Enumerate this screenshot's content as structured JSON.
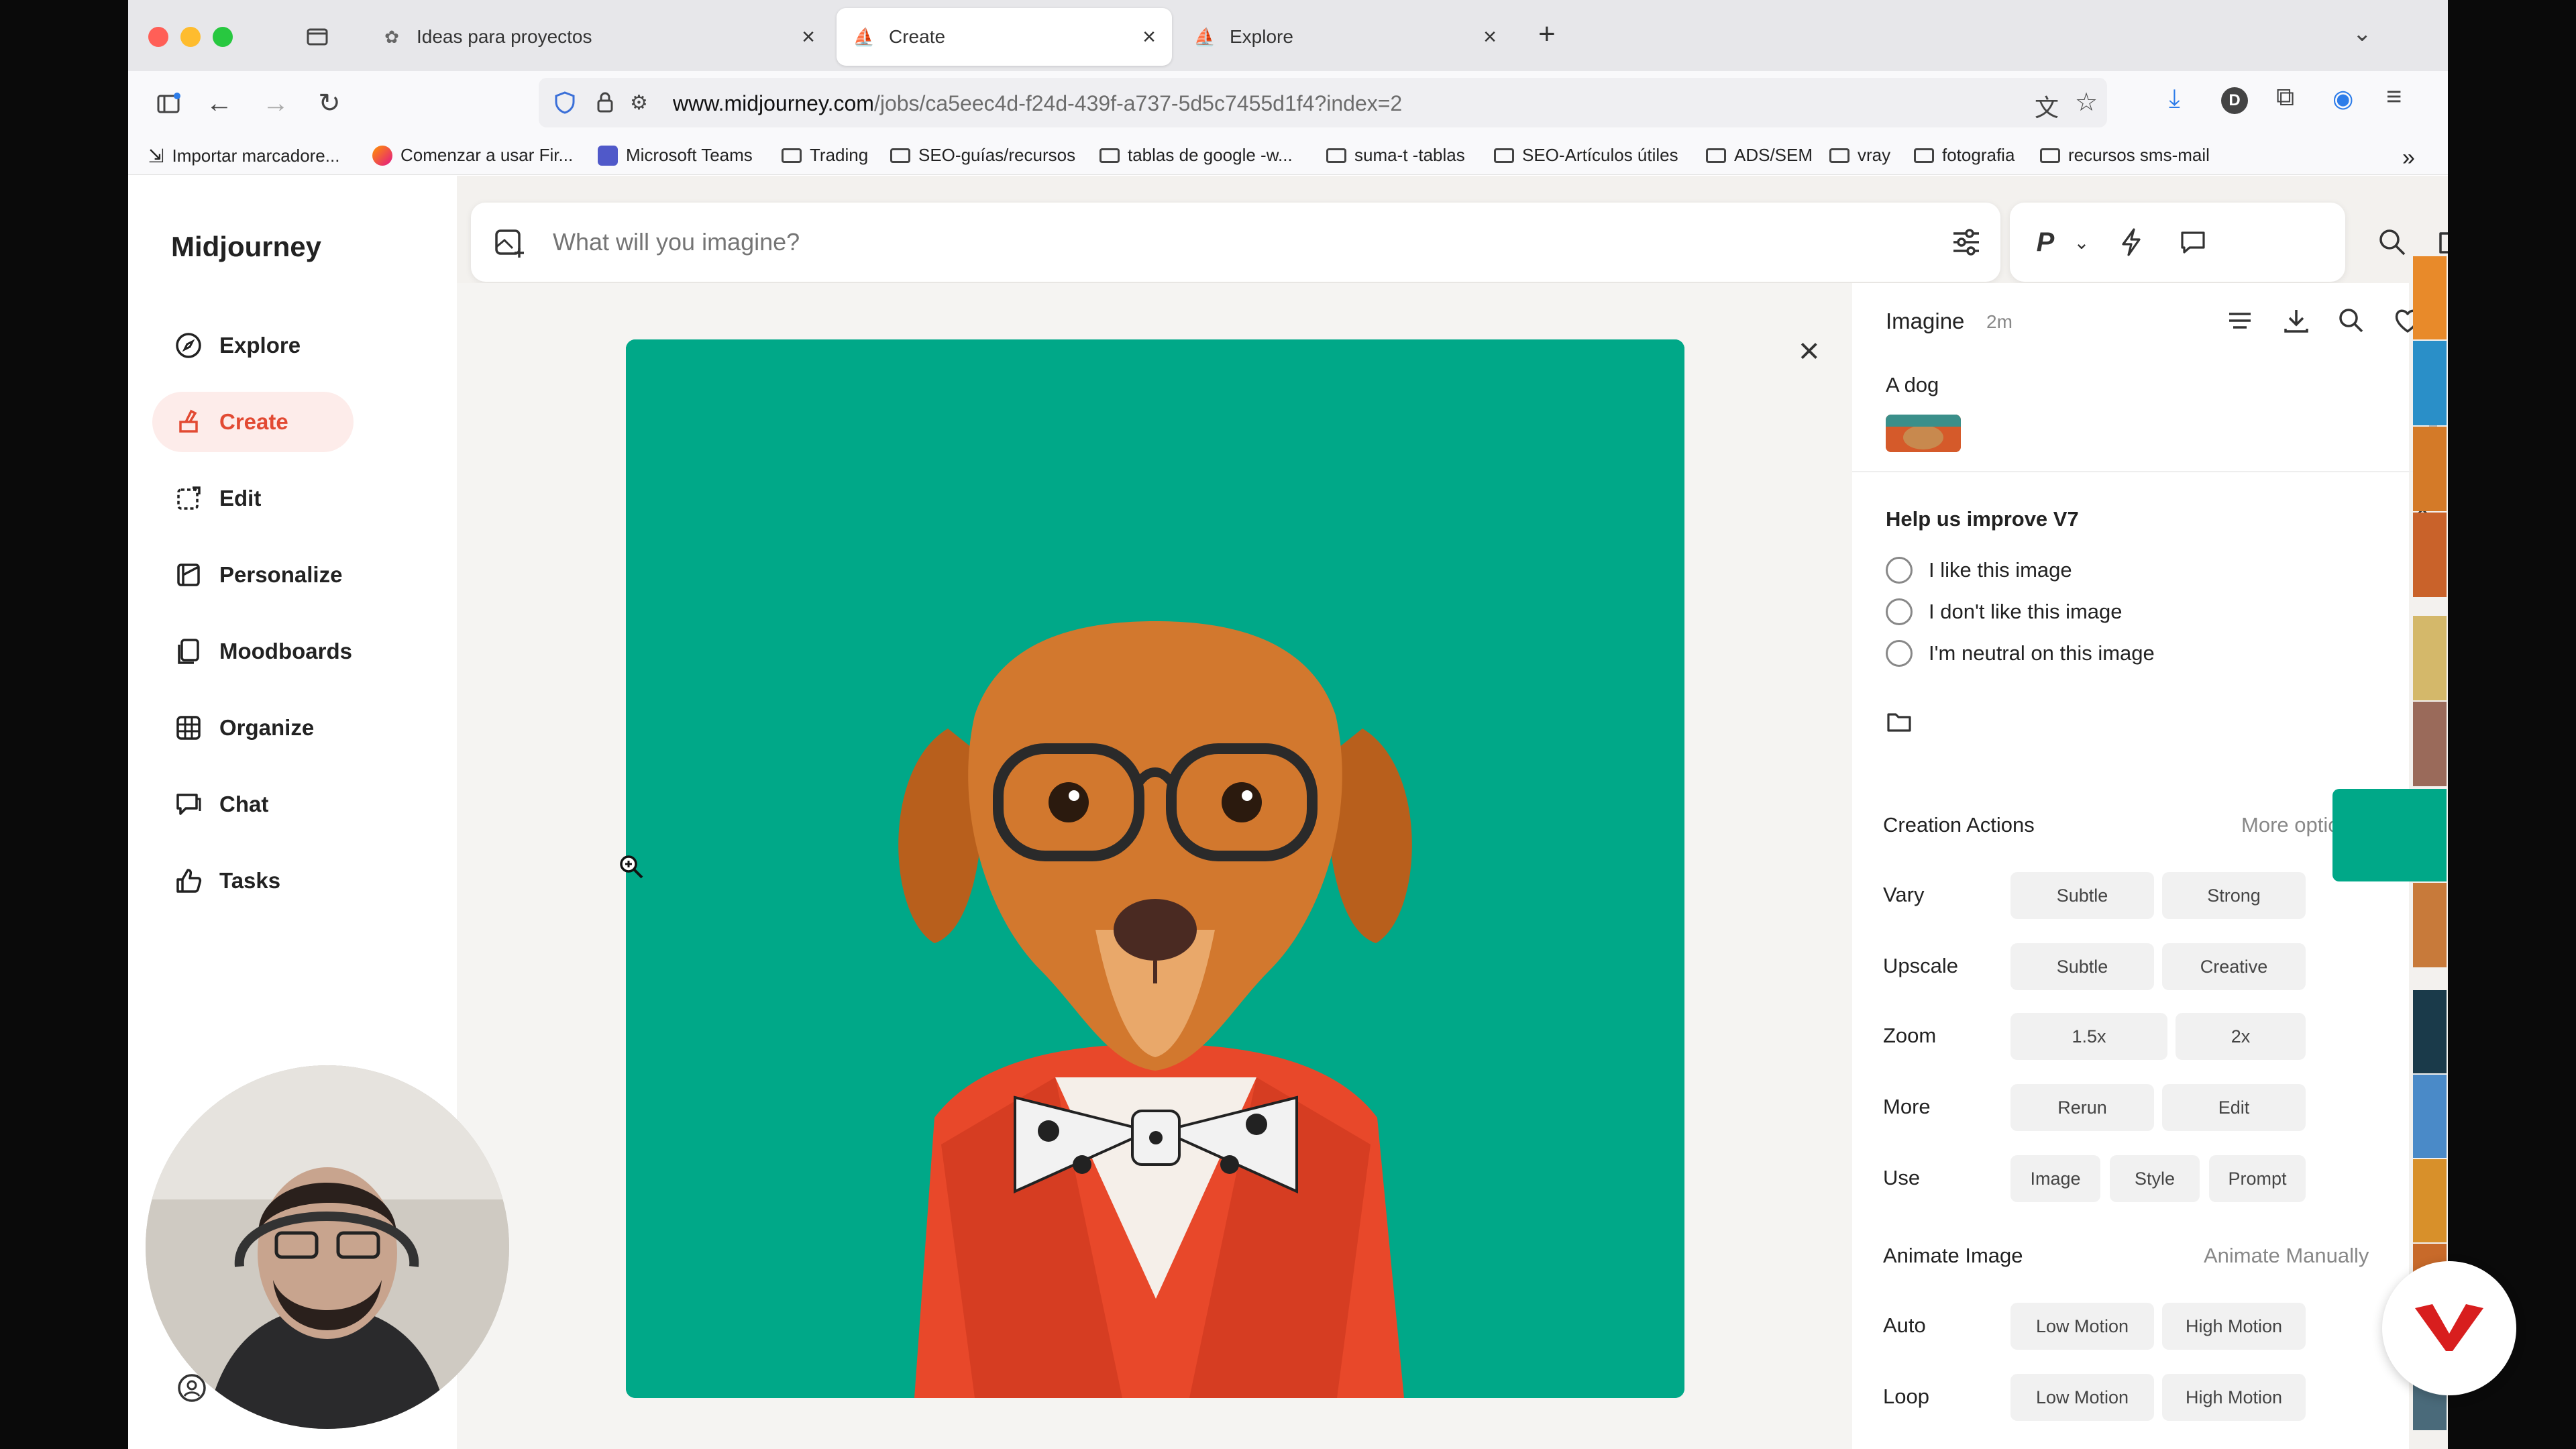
{
  "browser": {
    "tabs": [
      {
        "label": "Ideas para proyectos",
        "icon": "openai-icon"
      },
      {
        "label": "Create",
        "icon": "midjourney-sail-icon"
      },
      {
        "label": "Explore",
        "icon": "midjourney-sail-icon"
      }
    ],
    "url_host": "www.midjourney.com",
    "url_path": "/jobs/ca5eec4d-f24d-439f-a737-5d5c7455d1f4?index=2",
    "bookmarks": [
      "Importar marcadore...",
      "Comenzar a usar Fir...",
      "Microsoft Teams",
      "Trading",
      "SEO-guías/recursos",
      "tablas de google -w...",
      "suma-t -tablas",
      "SEO-Artículos útiles",
      "ADS/SEM",
      "vray",
      "fotografia",
      "recursos sms-mail"
    ],
    "profile_initial": "D"
  },
  "sidebar": {
    "logo": "Midjourney",
    "items": [
      {
        "label": "Explore",
        "icon": "compass-icon"
      },
      {
        "label": "Create",
        "icon": "paintbrush-icon"
      },
      {
        "label": "Edit",
        "icon": "edit-icon"
      },
      {
        "label": "Personalize",
        "icon": "personalize-icon"
      },
      {
        "label": "Moodboards",
        "icon": "moodboard-icon"
      },
      {
        "label": "Organize",
        "icon": "grid-icon"
      },
      {
        "label": "Chat",
        "icon": "chat-icon"
      },
      {
        "label": "Tasks",
        "icon": "thumbs-up-icon"
      }
    ]
  },
  "search": {
    "placeholder": "What will you imagine?",
    "mode_letter": "P"
  },
  "panel": {
    "header": "Imagine",
    "time": "2m",
    "prompt": "A dog",
    "feedback_title": "Help us improve V7",
    "feedback_options": [
      "I like this image",
      "I don't like this image",
      "I'm neutral on this image"
    ],
    "creation_actions_title": "Creation Actions",
    "more_options": "More options",
    "rows": [
      {
        "label": "Vary",
        "buttons": [
          "Subtle",
          "Strong"
        ]
      },
      {
        "label": "Upscale",
        "buttons": [
          "Subtle",
          "Creative"
        ]
      },
      {
        "label": "Zoom",
        "buttons": [
          "1.5x",
          "2x"
        ]
      },
      {
        "label": "More",
        "buttons": [
          "Rerun",
          "Edit"
        ]
      },
      {
        "label": "Use",
        "buttons": [
          "Image",
          "Style",
          "Prompt"
        ]
      }
    ],
    "animate_title": "Animate Image",
    "animate_manually": "Animate Manually",
    "animate_rows": [
      {
        "label": "Auto",
        "buttons": [
          "Low Motion",
          "High Motion"
        ]
      },
      {
        "label": "Loop",
        "buttons": [
          "Low Motion",
          "High Motion"
        ]
      }
    ]
  },
  "colors": {
    "image_background": "#00a888",
    "accent": "#e24a33",
    "active_nav_bg": "#fdecea"
  }
}
